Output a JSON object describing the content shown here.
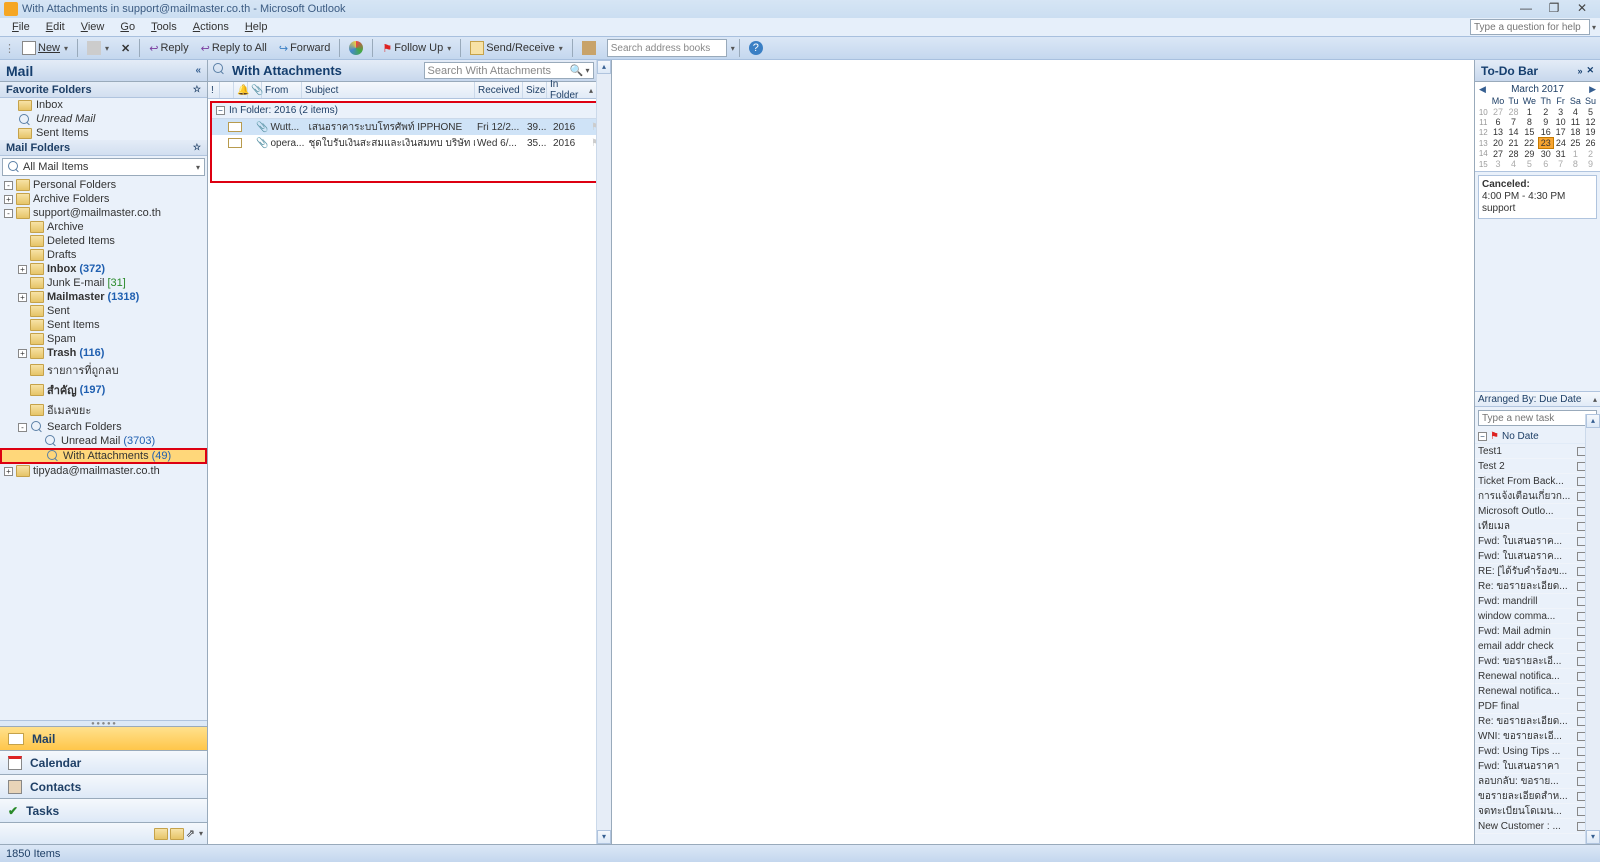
{
  "title": "With Attachments in support@mailmaster.co.th - Microsoft Outlook",
  "menu": [
    "File",
    "Edit",
    "View",
    "Go",
    "Tools",
    "Actions",
    "Help"
  ],
  "helpPlaceholder": "Type a question for help",
  "toolbar": {
    "new": "New",
    "reply": "Reply",
    "replyAll": "Reply to All",
    "forward": "Forward",
    "followUp": "Follow Up",
    "sendReceive": "Send/Receive",
    "searchPlaceholder": "Search address books"
  },
  "nav": {
    "mailHeader": "Mail",
    "favHeader": "Favorite Folders",
    "favItems": [
      {
        "label": "Inbox"
      },
      {
        "label": "Unread Mail",
        "italic": true
      },
      {
        "label": "Sent Items"
      }
    ],
    "mailFoldersHeader": "Mail Folders",
    "allMail": "All Mail Items",
    "tree": [
      {
        "level": 0,
        "exp": "-",
        "icon": "personal",
        "label": "Personal Folders"
      },
      {
        "level": 0,
        "exp": "+",
        "icon": "archive",
        "label": "Archive Folders"
      },
      {
        "level": 0,
        "exp": "-",
        "icon": "mailbox",
        "label": "support@mailmaster.co.th"
      },
      {
        "level": 1,
        "exp": "",
        "icon": "fldr",
        "label": "Archive"
      },
      {
        "level": 1,
        "exp": "",
        "icon": "fldr",
        "label": "Deleted Items"
      },
      {
        "level": 1,
        "exp": "",
        "icon": "fldr",
        "label": "Drafts"
      },
      {
        "level": 1,
        "exp": "+",
        "icon": "fldr",
        "label": "Inbox",
        "count": "(372)",
        "bold": true,
        "cc": "bluecnt"
      },
      {
        "level": 1,
        "exp": "",
        "icon": "junk",
        "label": "Junk E-mail",
        "count": "[31]",
        "cc": "greencnt"
      },
      {
        "level": 1,
        "exp": "+",
        "icon": "fldr",
        "label": "Mailmaster",
        "count": "(1318)",
        "bold": true,
        "cc": "bluecnt"
      },
      {
        "level": 1,
        "exp": "",
        "icon": "fldr",
        "label": "Sent"
      },
      {
        "level": 1,
        "exp": "",
        "icon": "fldr",
        "label": "Sent Items"
      },
      {
        "level": 1,
        "exp": "",
        "icon": "fldr",
        "label": "Spam"
      },
      {
        "level": 1,
        "exp": "+",
        "icon": "trash",
        "label": "Trash",
        "count": "(116)",
        "bold": true,
        "cc": "bluecnt"
      },
      {
        "level": 1,
        "exp": "",
        "icon": "fldr",
        "label": "รายการที่ถูกลบ"
      },
      {
        "level": 1,
        "exp": "",
        "icon": "fldr",
        "label": "สำคัญ",
        "count": "(197)",
        "bold": true,
        "cc": "bluecnt"
      },
      {
        "level": 1,
        "exp": "",
        "icon": "fldr",
        "label": "อีเมลขยะ"
      },
      {
        "level": 1,
        "exp": "-",
        "icon": "search",
        "label": "Search Folders"
      },
      {
        "level": 2,
        "exp": "",
        "icon": "search",
        "label": "Unread Mail",
        "count": "(3703)",
        "cc": "bluecnt"
      },
      {
        "level": 2,
        "exp": "",
        "icon": "search",
        "label": "With Attachments",
        "count": "(49)",
        "cc": "bluecnt",
        "selected": true
      },
      {
        "level": 0,
        "exp": "+",
        "icon": "mailbox",
        "label": "tipyada@mailmaster.co.th"
      }
    ],
    "buttons": [
      {
        "label": "Mail",
        "active": true
      },
      {
        "label": "Calendar"
      },
      {
        "label": "Contacts"
      },
      {
        "label": "Tasks"
      }
    ]
  },
  "list": {
    "title": "With Attachments",
    "searchPlaceholder": "Search With Attachments",
    "cols": [
      "!",
      "",
      "",
      "",
      "From",
      "Subject",
      "Received",
      "Size",
      "In Folder"
    ],
    "groupHeader": "In Folder: 2016 (2 items)",
    "messages": [
      {
        "from": "Wutt...",
        "subject": "เสนอราคาระบบโทรศัพท์ IPPHONE",
        "received": "Fri 12/2...",
        "size": "39...",
        "folder": "2016",
        "selected": true
      },
      {
        "from": "opera...",
        "subject": "ชุดใบรับเงินสะสมและเงินสมทบ บริษัท เด...",
        "received": "Wed 6/...",
        "size": "35...",
        "folder": "2016"
      }
    ]
  },
  "todo": {
    "header": "To-Do Bar",
    "calTitle": "March 2017",
    "dow": [
      "Mo",
      "Tu",
      "We",
      "Th",
      "Fr",
      "Sa",
      "Su"
    ],
    "weeks": [
      {
        "wk": "10",
        "d": [
          "27",
          "28",
          "1",
          "2",
          "3",
          "4",
          "5"
        ],
        "grayTo": 1
      },
      {
        "wk": "11",
        "d": [
          "6",
          "7",
          "8",
          "9",
          "10",
          "11",
          "12"
        ]
      },
      {
        "wk": "12",
        "d": [
          "13",
          "14",
          "15",
          "16",
          "17",
          "18",
          "19"
        ]
      },
      {
        "wk": "13",
        "d": [
          "20",
          "21",
          "22",
          "23",
          "24",
          "25",
          "26"
        ],
        "today": 3
      },
      {
        "wk": "14",
        "d": [
          "27",
          "28",
          "29",
          "30",
          "31",
          "1",
          "2"
        ],
        "grayFrom": 5
      },
      {
        "wk": "15",
        "d": [
          "3",
          "4",
          "5",
          "6",
          "7",
          "8",
          "9"
        ],
        "grayFrom": 0
      }
    ],
    "appt": {
      "l1": "Canceled:",
      "l2": "4:00 PM - 4:30 PM",
      "l3": "support"
    },
    "arrange": "Arranged By: Due Date",
    "newTaskPlaceholder": "Type a new task",
    "groupLabel": "No Date",
    "tasks": [
      "Test1",
      "Test 2",
      "Ticket From Back...",
      "การแจ้งเตือนเกี่ยวก...",
      "Microsoft Outlo...",
      "เทียเมล",
      "Fwd: ใบเสนอราค...",
      "Fwd: ใบเสนอราค...",
      "RE: [ได้รับคำร้องข...",
      "Re: ขอรายละเอียด...",
      "Fwd: mandrill",
      "window comma...",
      "Fwd: Mail admin",
      "email addr check",
      "Fwd: ขอรายละเอี...",
      "Renewal notifica...",
      "Renewal notifica...",
      "PDF final",
      "Re: ขอรายละเอียด...",
      "WNI: ขอรายละเอี...",
      "Fwd: Using Tips ...",
      "Fwd: ใบเสนอราคา",
      "ลอบกลับ: ขอราย...",
      "ขอรายละเอียดสำห...",
      "จดทะเบียนโดเมน...",
      "New Customer : ..."
    ]
  },
  "status": "1850 Items"
}
